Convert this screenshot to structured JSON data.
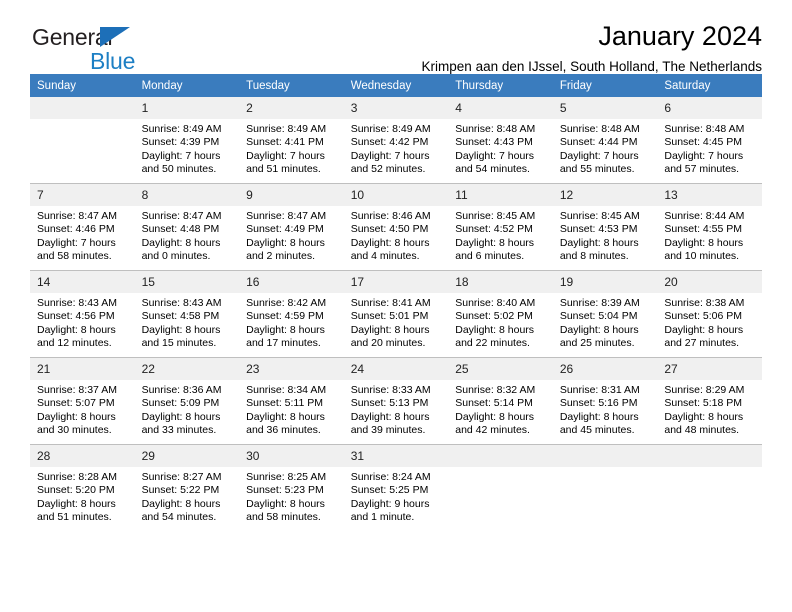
{
  "brand": {
    "name_part1": "General",
    "name_part2": "Blue",
    "accent_color": "#1d7fc4",
    "triangle_color": "#1d6fb8"
  },
  "header": {
    "title": "January 2024",
    "subtitle": "Krimpen aan den IJssel, South Holland, The Netherlands"
  },
  "calendar": {
    "header_bg": "#3a7cbe",
    "daynum_bg": "#f0f0f0",
    "weekday_headers": [
      "Sunday",
      "Monday",
      "Tuesday",
      "Wednesday",
      "Thursday",
      "Friday",
      "Saturday"
    ],
    "weeks": [
      [
        {
          "day": "",
          "empty": true,
          "sunrise": "",
          "sunset": "",
          "daylight1": "",
          "daylight2": ""
        },
        {
          "day": "1",
          "sunrise": "Sunrise: 8:49 AM",
          "sunset": "Sunset: 4:39 PM",
          "daylight1": "Daylight: 7 hours",
          "daylight2": "and 50 minutes."
        },
        {
          "day": "2",
          "sunrise": "Sunrise: 8:49 AM",
          "sunset": "Sunset: 4:41 PM",
          "daylight1": "Daylight: 7 hours",
          "daylight2": "and 51 minutes."
        },
        {
          "day": "3",
          "sunrise": "Sunrise: 8:49 AM",
          "sunset": "Sunset: 4:42 PM",
          "daylight1": "Daylight: 7 hours",
          "daylight2": "and 52 minutes."
        },
        {
          "day": "4",
          "sunrise": "Sunrise: 8:48 AM",
          "sunset": "Sunset: 4:43 PM",
          "daylight1": "Daylight: 7 hours",
          "daylight2": "and 54 minutes."
        },
        {
          "day": "5",
          "sunrise": "Sunrise: 8:48 AM",
          "sunset": "Sunset: 4:44 PM",
          "daylight1": "Daylight: 7 hours",
          "daylight2": "and 55 minutes."
        },
        {
          "day": "6",
          "sunrise": "Sunrise: 8:48 AM",
          "sunset": "Sunset: 4:45 PM",
          "daylight1": "Daylight: 7 hours",
          "daylight2": "and 57 minutes."
        }
      ],
      [
        {
          "day": "7",
          "sunrise": "Sunrise: 8:47 AM",
          "sunset": "Sunset: 4:46 PM",
          "daylight1": "Daylight: 7 hours",
          "daylight2": "and 58 minutes."
        },
        {
          "day": "8",
          "sunrise": "Sunrise: 8:47 AM",
          "sunset": "Sunset: 4:48 PM",
          "daylight1": "Daylight: 8 hours",
          "daylight2": "and 0 minutes."
        },
        {
          "day": "9",
          "sunrise": "Sunrise: 8:47 AM",
          "sunset": "Sunset: 4:49 PM",
          "daylight1": "Daylight: 8 hours",
          "daylight2": "and 2 minutes."
        },
        {
          "day": "10",
          "sunrise": "Sunrise: 8:46 AM",
          "sunset": "Sunset: 4:50 PM",
          "daylight1": "Daylight: 8 hours",
          "daylight2": "and 4 minutes."
        },
        {
          "day": "11",
          "sunrise": "Sunrise: 8:45 AM",
          "sunset": "Sunset: 4:52 PM",
          "daylight1": "Daylight: 8 hours",
          "daylight2": "and 6 minutes."
        },
        {
          "day": "12",
          "sunrise": "Sunrise: 8:45 AM",
          "sunset": "Sunset: 4:53 PM",
          "daylight1": "Daylight: 8 hours",
          "daylight2": "and 8 minutes."
        },
        {
          "day": "13",
          "sunrise": "Sunrise: 8:44 AM",
          "sunset": "Sunset: 4:55 PM",
          "daylight1": "Daylight: 8 hours",
          "daylight2": "and 10 minutes."
        }
      ],
      [
        {
          "day": "14",
          "sunrise": "Sunrise: 8:43 AM",
          "sunset": "Sunset: 4:56 PM",
          "daylight1": "Daylight: 8 hours",
          "daylight2": "and 12 minutes."
        },
        {
          "day": "15",
          "sunrise": "Sunrise: 8:43 AM",
          "sunset": "Sunset: 4:58 PM",
          "daylight1": "Daylight: 8 hours",
          "daylight2": "and 15 minutes."
        },
        {
          "day": "16",
          "sunrise": "Sunrise: 8:42 AM",
          "sunset": "Sunset: 4:59 PM",
          "daylight1": "Daylight: 8 hours",
          "daylight2": "and 17 minutes."
        },
        {
          "day": "17",
          "sunrise": "Sunrise: 8:41 AM",
          "sunset": "Sunset: 5:01 PM",
          "daylight1": "Daylight: 8 hours",
          "daylight2": "and 20 minutes."
        },
        {
          "day": "18",
          "sunrise": "Sunrise: 8:40 AM",
          "sunset": "Sunset: 5:02 PM",
          "daylight1": "Daylight: 8 hours",
          "daylight2": "and 22 minutes."
        },
        {
          "day": "19",
          "sunrise": "Sunrise: 8:39 AM",
          "sunset": "Sunset: 5:04 PM",
          "daylight1": "Daylight: 8 hours",
          "daylight2": "and 25 minutes."
        },
        {
          "day": "20",
          "sunrise": "Sunrise: 8:38 AM",
          "sunset": "Sunset: 5:06 PM",
          "daylight1": "Daylight: 8 hours",
          "daylight2": "and 27 minutes."
        }
      ],
      [
        {
          "day": "21",
          "sunrise": "Sunrise: 8:37 AM",
          "sunset": "Sunset: 5:07 PM",
          "daylight1": "Daylight: 8 hours",
          "daylight2": "and 30 minutes."
        },
        {
          "day": "22",
          "sunrise": "Sunrise: 8:36 AM",
          "sunset": "Sunset: 5:09 PM",
          "daylight1": "Daylight: 8 hours",
          "daylight2": "and 33 minutes."
        },
        {
          "day": "23",
          "sunrise": "Sunrise: 8:34 AM",
          "sunset": "Sunset: 5:11 PM",
          "daylight1": "Daylight: 8 hours",
          "daylight2": "and 36 minutes."
        },
        {
          "day": "24",
          "sunrise": "Sunrise: 8:33 AM",
          "sunset": "Sunset: 5:13 PM",
          "daylight1": "Daylight: 8 hours",
          "daylight2": "and 39 minutes."
        },
        {
          "day": "25",
          "sunrise": "Sunrise: 8:32 AM",
          "sunset": "Sunset: 5:14 PM",
          "daylight1": "Daylight: 8 hours",
          "daylight2": "and 42 minutes."
        },
        {
          "day": "26",
          "sunrise": "Sunrise: 8:31 AM",
          "sunset": "Sunset: 5:16 PM",
          "daylight1": "Daylight: 8 hours",
          "daylight2": "and 45 minutes."
        },
        {
          "day": "27",
          "sunrise": "Sunrise: 8:29 AM",
          "sunset": "Sunset: 5:18 PM",
          "daylight1": "Daylight: 8 hours",
          "daylight2": "and 48 minutes."
        }
      ],
      [
        {
          "day": "28",
          "sunrise": "Sunrise: 8:28 AM",
          "sunset": "Sunset: 5:20 PM",
          "daylight1": "Daylight: 8 hours",
          "daylight2": "and 51 minutes."
        },
        {
          "day": "29",
          "sunrise": "Sunrise: 8:27 AM",
          "sunset": "Sunset: 5:22 PM",
          "daylight1": "Daylight: 8 hours",
          "daylight2": "and 54 minutes."
        },
        {
          "day": "30",
          "sunrise": "Sunrise: 8:25 AM",
          "sunset": "Sunset: 5:23 PM",
          "daylight1": "Daylight: 8 hours",
          "daylight2": "and 58 minutes."
        },
        {
          "day": "31",
          "sunrise": "Sunrise: 8:24 AM",
          "sunset": "Sunset: 5:25 PM",
          "daylight1": "Daylight: 9 hours",
          "daylight2": "and 1 minute."
        },
        {
          "day": "",
          "empty": true,
          "sunrise": "",
          "sunset": "",
          "daylight1": "",
          "daylight2": ""
        },
        {
          "day": "",
          "empty": true,
          "sunrise": "",
          "sunset": "",
          "daylight1": "",
          "daylight2": ""
        },
        {
          "day": "",
          "empty": true,
          "sunrise": "",
          "sunset": "",
          "daylight1": "",
          "daylight2": ""
        }
      ]
    ]
  }
}
